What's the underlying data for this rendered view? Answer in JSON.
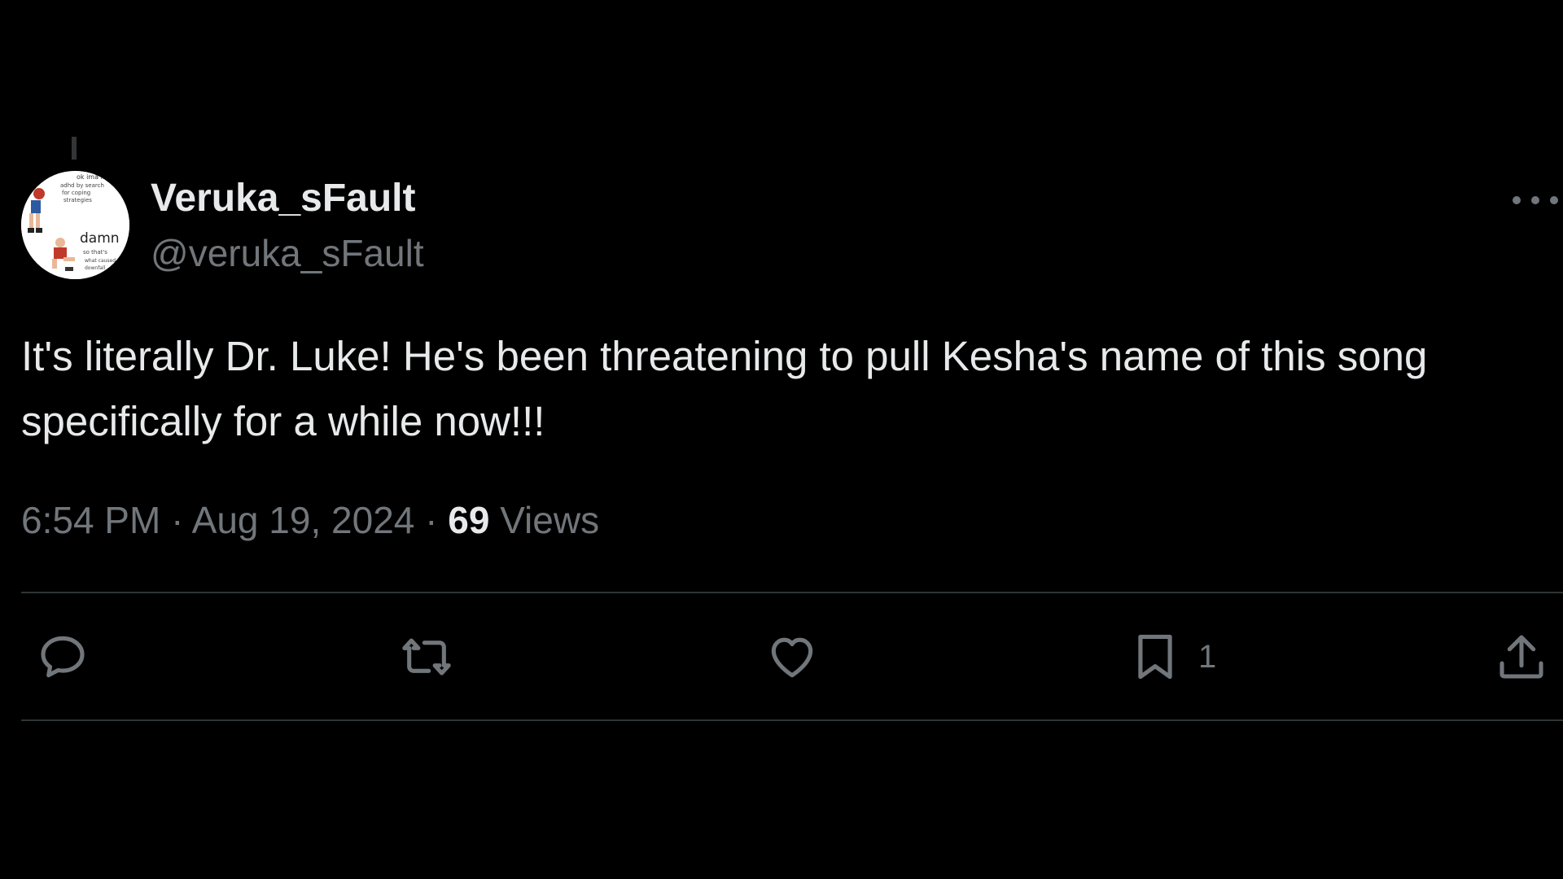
{
  "tweet": {
    "author": {
      "display_name": "Veruka_sFault",
      "handle": "@veruka_sFault",
      "avatar_text": [
        "ok ima figure",
        "adhd by search",
        "for coping",
        "strategies",
        "damn",
        "so that's",
        "what caused",
        "downfall"
      ]
    },
    "text": "It's literally Dr. Luke! He's been threatening to pull Kesha's name of this song specifically for a while now!!!",
    "time": "6:54 PM",
    "separator": "·",
    "date": "Aug 19, 2024",
    "views_count": "69",
    "views_label": "Views"
  },
  "actions": {
    "reply": {
      "icon": "reply-icon"
    },
    "repost": {
      "icon": "repost-icon"
    },
    "like": {
      "icon": "heart-icon"
    },
    "bookmark": {
      "icon": "bookmark-icon",
      "count": "1"
    },
    "share": {
      "icon": "share-icon"
    }
  },
  "colors": {
    "background": "#000000",
    "primary_text": "#e7e9ea",
    "secondary_text": "#71767b",
    "divider": "#2f3336"
  }
}
